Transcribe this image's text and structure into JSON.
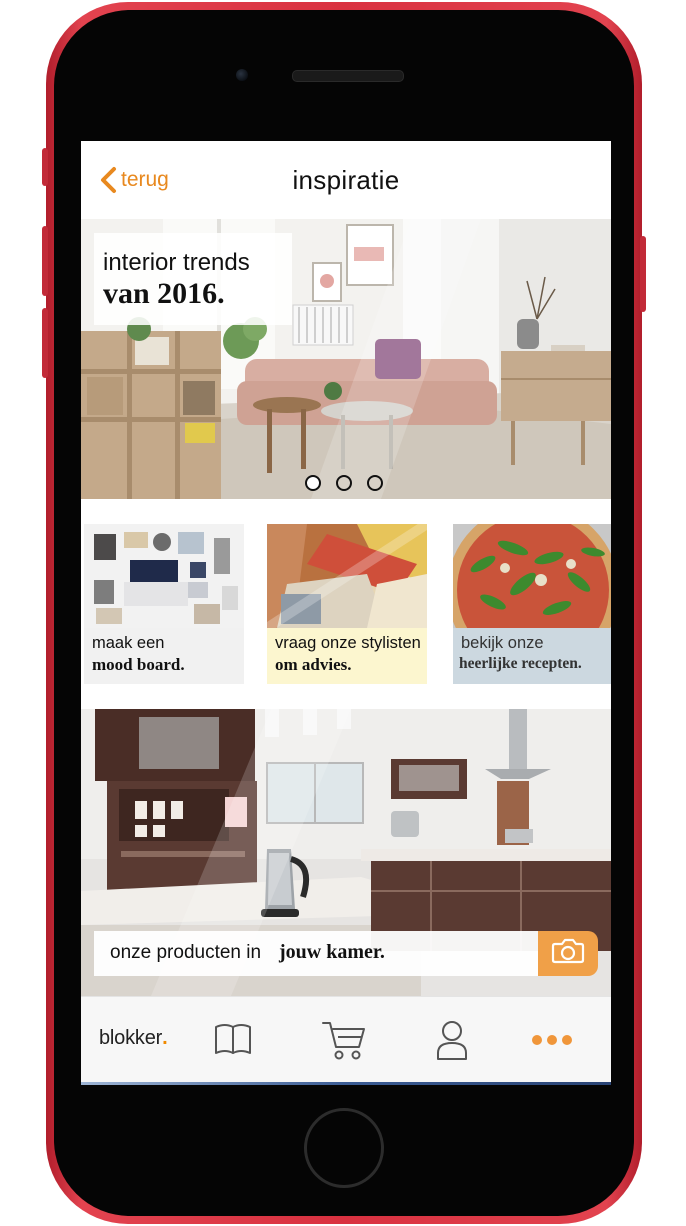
{
  "header": {
    "back_label": "terug",
    "title": "inspiratie"
  },
  "hero": {
    "line1": "interior trends",
    "line2": "van 2016.",
    "carousel_pages": 3,
    "active_page": 1
  },
  "tiles": [
    {
      "line1": "maak een",
      "line2": "mood board."
    },
    {
      "line1": "vraag onze stylisten",
      "line2": "om advies."
    },
    {
      "line1": "bekijk onze",
      "line2": "heerlijke recepten."
    }
  ],
  "room_search": {
    "text_regular": "onze producten in",
    "text_bold": "jouw kamer."
  },
  "tabbar": {
    "logo_text": "blokker",
    "logo_dot": ".",
    "icons": [
      "book-icon",
      "cart-icon",
      "user-icon",
      "more-icon"
    ]
  },
  "colors": {
    "accent": "#e8891f",
    "camera_button": "#f0a048",
    "phone_frame": "#d93140"
  }
}
